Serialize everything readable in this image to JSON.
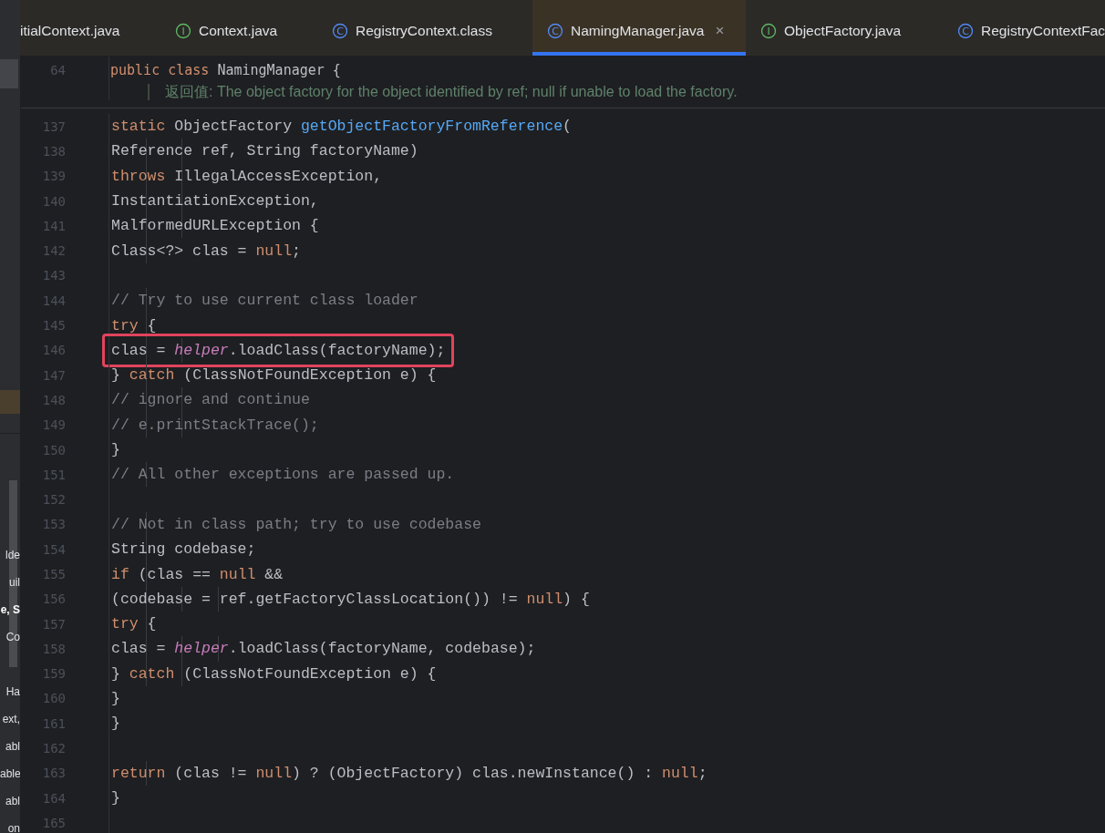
{
  "tabs": [
    {
      "label": "itialContext.java",
      "kind": "none",
      "selected": false
    },
    {
      "label": "Context.java",
      "kind": "interface",
      "icon_letter": "I",
      "selected": false
    },
    {
      "label": "RegistryContext.class",
      "kind": "class",
      "icon_letter": "C",
      "selected": false
    },
    {
      "label": "NamingManager.java",
      "kind": "class",
      "icon_letter": "C",
      "selected": true,
      "close": "×"
    },
    {
      "label": "ObjectFactory.java",
      "kind": "interface",
      "icon_letter": "I",
      "selected": false
    },
    {
      "label": "RegistryContextFac",
      "kind": "class",
      "icon_letter": "C",
      "selected": false
    }
  ],
  "side_panel": {
    "group_a": [
      {
        "text": "lde",
        "selected": false
      },
      {
        "text": "uil",
        "selected": false
      },
      {
        "text": "e, S",
        "selected": true
      },
      {
        "text": "Co",
        "selected": false
      }
    ],
    "group_b": [
      {
        "text": "Ha",
        "selected": false
      },
      {
        "text": "ext,",
        "selected": false
      },
      {
        "text": "abl",
        "selected": false
      },
      {
        "text": "able",
        "selected": false
      },
      {
        "text": "abl",
        "selected": false
      },
      {
        "text": "on",
        "selected": false
      }
    ]
  },
  "sticky_header": {
    "number": "64",
    "tokens": [
      {
        "text": "public class ",
        "kind": "kw"
      },
      {
        "text": "NamingManager {",
        "kind": "plain"
      }
    ]
  },
  "doc_line": "返回值: The object factory for the object identified by ref; null if unable to load the factory.",
  "lines": [
    {
      "number": "137",
      "highlighted": false,
      "tokens": [
        {
          "text": "    static ",
          "kind": "kw"
        },
        {
          "text": "ObjectFactory ",
          "kind": "plain"
        },
        {
          "text": "getObjectFactoryFromReference",
          "kind": "fn"
        },
        {
          "text": "(",
          "kind": "plain"
        }
      ]
    },
    {
      "number": "138",
      "highlighted": false,
      "tokens": [
        {
          "text": "            Reference ref, String factoryName)",
          "kind": "plain"
        }
      ]
    },
    {
      "number": "139",
      "highlighted": false,
      "tokens": [
        {
          "text": "            throws ",
          "kind": "kw"
        },
        {
          "text": "IllegalAccessException,",
          "kind": "plain"
        }
      ]
    },
    {
      "number": "140",
      "highlighted": false,
      "tokens": [
        {
          "text": "            InstantiationException,",
          "kind": "plain"
        }
      ]
    },
    {
      "number": "141",
      "highlighted": false,
      "tokens": [
        {
          "text": "            MalformedURLException {",
          "kind": "plain"
        }
      ]
    },
    {
      "number": "142",
      "highlighted": false,
      "tokens": [
        {
          "text": "        Class<?> clas = ",
          "kind": "plain"
        },
        {
          "text": "null",
          "kind": "kw"
        },
        {
          "text": ";",
          "kind": "plain"
        }
      ]
    },
    {
      "number": "143",
      "highlighted": false
    },
    {
      "number": "144",
      "highlighted": false,
      "tokens": [
        {
          "text": "        // Try to use current class loader",
          "kind": "comment"
        }
      ]
    },
    {
      "number": "145",
      "highlighted": false,
      "tokens": [
        {
          "text": "        try ",
          "kind": "kw"
        },
        {
          "text": "{",
          "kind": "plain"
        }
      ]
    },
    {
      "number": "146",
      "highlighted": true,
      "tokens": [
        {
          "text": "            clas = ",
          "kind": "plain"
        },
        {
          "text": "helper",
          "kind": "field"
        },
        {
          "text": ".loadClass(factoryName);",
          "kind": "plain"
        }
      ]
    },
    {
      "number": "147",
      "highlighted": false,
      "tokens": [
        {
          "text": "        } ",
          "kind": "plain"
        },
        {
          "text": "catch ",
          "kind": "kw"
        },
        {
          "text": "(ClassNotFoundException e) {",
          "kind": "plain"
        }
      ]
    },
    {
      "number": "148",
      "highlighted": false,
      "tokens": [
        {
          "text": "            // ignore and continue",
          "kind": "comment"
        }
      ]
    },
    {
      "number": "149",
      "highlighted": false,
      "tokens": [
        {
          "text": "            // e.printStackTrace();",
          "kind": "comment"
        }
      ]
    },
    {
      "number": "150",
      "highlighted": false,
      "tokens": [
        {
          "text": "        }",
          "kind": "plain"
        }
      ]
    },
    {
      "number": "151",
      "highlighted": false,
      "tokens": [
        {
          "text": "        // All other exceptions are passed up.",
          "kind": "comment"
        }
      ]
    },
    {
      "number": "152",
      "highlighted": false
    },
    {
      "number": "153",
      "highlighted": false,
      "tokens": [
        {
          "text": "        // Not in class path; try to use codebase",
          "kind": "comment"
        }
      ]
    },
    {
      "number": "154",
      "highlighted": false,
      "tokens": [
        {
          "text": "        String codebase;",
          "kind": "plain"
        }
      ]
    },
    {
      "number": "155",
      "highlighted": false,
      "tokens": [
        {
          "text": "        if ",
          "kind": "kw"
        },
        {
          "text": "(clas == ",
          "kind": "plain"
        },
        {
          "text": "null ",
          "kind": "kw"
        },
        {
          "text": "&&",
          "kind": "plain"
        }
      ]
    },
    {
      "number": "156",
      "highlighted": false,
      "tokens": [
        {
          "text": "                (codebase = ref.getFactoryClassLocation()) != ",
          "kind": "plain"
        },
        {
          "text": "null",
          "kind": "kw"
        },
        {
          "text": ") {",
          "kind": "plain"
        }
      ]
    },
    {
      "number": "157",
      "highlighted": false,
      "tokens": [
        {
          "text": "            try ",
          "kind": "kw"
        },
        {
          "text": "{",
          "kind": "plain"
        }
      ]
    },
    {
      "number": "158",
      "highlighted": false,
      "tokens": [
        {
          "text": "                clas = ",
          "kind": "plain"
        },
        {
          "text": "helper",
          "kind": "field"
        },
        {
          "text": ".loadClass(factoryName, codebase);",
          "kind": "plain"
        }
      ]
    },
    {
      "number": "159",
      "highlighted": false,
      "tokens": [
        {
          "text": "            } ",
          "kind": "plain"
        },
        {
          "text": "catch ",
          "kind": "kw"
        },
        {
          "text": "(ClassNotFoundException e) {",
          "kind": "plain"
        }
      ]
    },
    {
      "number": "160",
      "highlighted": false,
      "tokens": [
        {
          "text": "            }",
          "kind": "plain"
        }
      ]
    },
    {
      "number": "161",
      "highlighted": false,
      "tokens": [
        {
          "text": "        }",
          "kind": "plain"
        }
      ]
    },
    {
      "number": "162",
      "highlighted": false
    },
    {
      "number": "163",
      "highlighted": false,
      "tokens": [
        {
          "text": "        return ",
          "kind": "kw"
        },
        {
          "text": "(clas != ",
          "kind": "plain"
        },
        {
          "text": "null",
          "kind": "kw"
        },
        {
          "text": ") ? (ObjectFactory) clas.newInstance() : ",
          "kind": "plain"
        },
        {
          "text": "null",
          "kind": "kw"
        },
        {
          "text": ";",
          "kind": "plain"
        }
      ]
    },
    {
      "number": "164",
      "highlighted": false,
      "tokens": [
        {
          "text": "    }",
          "kind": "plain"
        }
      ]
    },
    {
      "number": "165",
      "highlighted": false
    }
  ]
}
